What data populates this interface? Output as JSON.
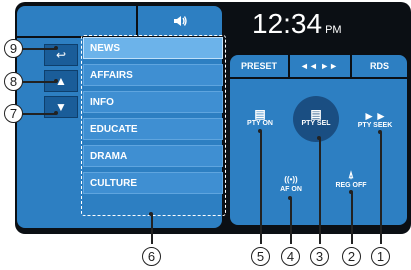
{
  "header": {
    "volume_icon": "volume-icon"
  },
  "side_buttons": [
    {
      "icon": "back-arrow-icon",
      "glyph": "↩"
    },
    {
      "icon": "up-arrow-icon",
      "glyph": "▲"
    },
    {
      "icon": "down-arrow-icon",
      "glyph": "▼"
    }
  ],
  "list_items": [
    "NEWS",
    "AFFAIRS",
    "INFO",
    "EDUCATE",
    "DRAMA",
    "CULTURE"
  ],
  "selected_index": 0,
  "clock": {
    "time": "12:34",
    "suffix": "PM"
  },
  "tabs": {
    "preset": "PRESET",
    "seek": "◄◄ ►►",
    "rds": "RDS"
  },
  "controls": {
    "pty_on": "PTY  ON",
    "pty_sel": "PTY SEL",
    "pty_seek": "PTY SEEK",
    "af_on": "AF  ON",
    "reg_off": "REG OFF"
  },
  "callouts": {
    "c1": "1",
    "c2": "2",
    "c3": "3",
    "c4": "4",
    "c5": "5",
    "c6": "6",
    "c7": "7",
    "c8": "8",
    "c9": "9"
  }
}
